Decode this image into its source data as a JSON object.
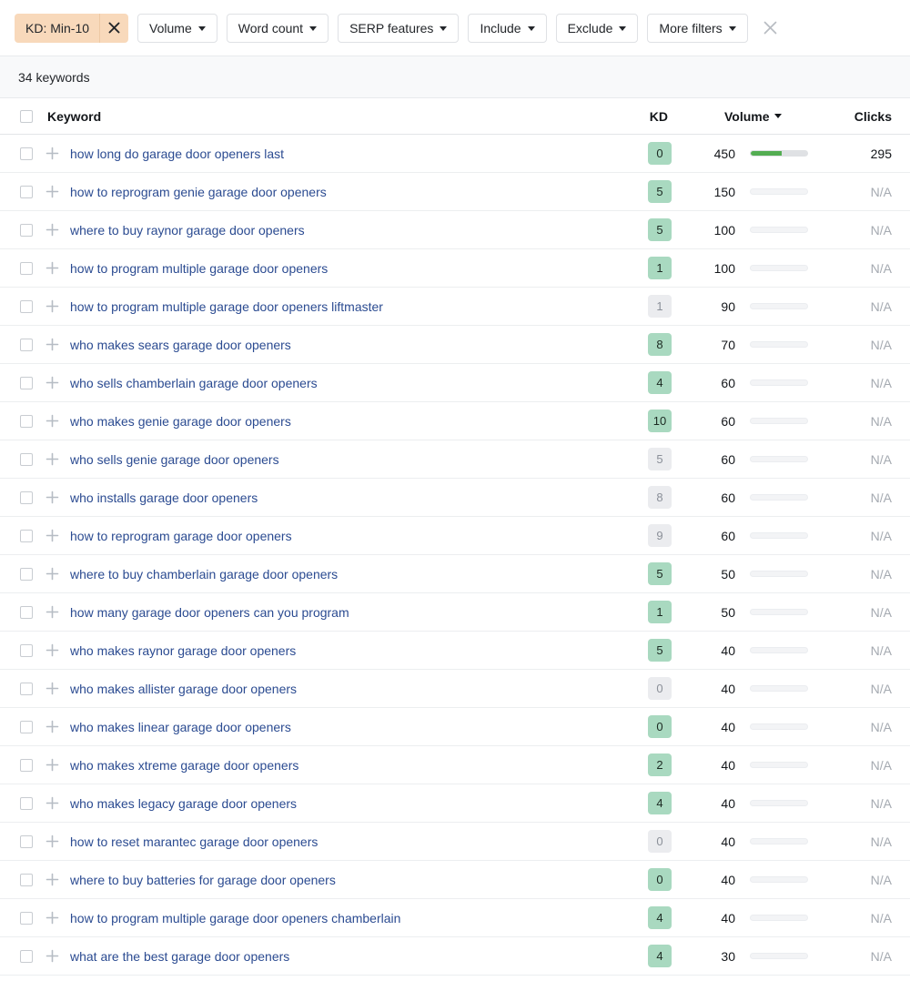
{
  "filters": {
    "active_chip": {
      "label": "KD: Min-10",
      "remove_icon": "close-icon"
    },
    "buttons": [
      {
        "label": "Volume"
      },
      {
        "label": "Word count"
      },
      {
        "label": "SERP features"
      },
      {
        "label": "Include"
      },
      {
        "label": "Exclude"
      },
      {
        "label": "More filters"
      }
    ],
    "clear_all_icon": "close-icon"
  },
  "count_bar": {
    "text": "34 keywords"
  },
  "table": {
    "headers": {
      "keyword": "Keyword",
      "kd": "KD",
      "volume": "Volume",
      "volume_sort_icon": "sort-descending-caret",
      "clicks": "Clicks"
    },
    "rows": [
      {
        "keyword": "how long do garage door openers last",
        "kd": "0",
        "kd_style": "green",
        "volume": "450",
        "bar_pct": 55,
        "bar_style": "filled",
        "clicks": "295",
        "clicks_na": false
      },
      {
        "keyword": "how to reprogram genie garage door openers",
        "kd": "5",
        "kd_style": "green",
        "volume": "150",
        "bar_pct": 0,
        "bar_style": "empty",
        "clicks": "N/A",
        "clicks_na": true
      },
      {
        "keyword": "where to buy raynor garage door openers",
        "kd": "5",
        "kd_style": "green",
        "volume": "100",
        "bar_pct": 0,
        "bar_style": "empty",
        "clicks": "N/A",
        "clicks_na": true
      },
      {
        "keyword": "how to program multiple garage door openers",
        "kd": "1",
        "kd_style": "green",
        "volume": "100",
        "bar_pct": 0,
        "bar_style": "empty",
        "clicks": "N/A",
        "clicks_na": true
      },
      {
        "keyword": "how to program multiple garage door openers liftmaster",
        "kd": "1",
        "kd_style": "gray",
        "volume": "90",
        "bar_pct": 0,
        "bar_style": "empty",
        "clicks": "N/A",
        "clicks_na": true
      },
      {
        "keyword": "who makes sears garage door openers",
        "kd": "8",
        "kd_style": "green",
        "volume": "70",
        "bar_pct": 0,
        "bar_style": "empty",
        "clicks": "N/A",
        "clicks_na": true
      },
      {
        "keyword": "who sells chamberlain garage door openers",
        "kd": "4",
        "kd_style": "green",
        "volume": "60",
        "bar_pct": 0,
        "bar_style": "empty",
        "clicks": "N/A",
        "clicks_na": true
      },
      {
        "keyword": "who makes genie garage door openers",
        "kd": "10",
        "kd_style": "green",
        "volume": "60",
        "bar_pct": 0,
        "bar_style": "empty",
        "clicks": "N/A",
        "clicks_na": true
      },
      {
        "keyword": "who sells genie garage door openers",
        "kd": "5",
        "kd_style": "gray",
        "volume": "60",
        "bar_pct": 0,
        "bar_style": "empty",
        "clicks": "N/A",
        "clicks_na": true
      },
      {
        "keyword": "who installs garage door openers",
        "kd": "8",
        "kd_style": "gray",
        "volume": "60",
        "bar_pct": 0,
        "bar_style": "empty",
        "clicks": "N/A",
        "clicks_na": true
      },
      {
        "keyword": "how to reprogram garage door openers",
        "kd": "9",
        "kd_style": "gray",
        "volume": "60",
        "bar_pct": 0,
        "bar_style": "empty",
        "clicks": "N/A",
        "clicks_na": true
      },
      {
        "keyword": "where to buy chamberlain garage door openers",
        "kd": "5",
        "kd_style": "green",
        "volume": "50",
        "bar_pct": 0,
        "bar_style": "empty",
        "clicks": "N/A",
        "clicks_na": true
      },
      {
        "keyword": "how many garage door openers can you program",
        "kd": "1",
        "kd_style": "green",
        "volume": "50",
        "bar_pct": 0,
        "bar_style": "empty",
        "clicks": "N/A",
        "clicks_na": true
      },
      {
        "keyword": "who makes raynor garage door openers",
        "kd": "5",
        "kd_style": "green",
        "volume": "40",
        "bar_pct": 0,
        "bar_style": "empty",
        "clicks": "N/A",
        "clicks_na": true
      },
      {
        "keyword": "who makes allister garage door openers",
        "kd": "0",
        "kd_style": "gray",
        "volume": "40",
        "bar_pct": 0,
        "bar_style": "empty",
        "clicks": "N/A",
        "clicks_na": true
      },
      {
        "keyword": "who makes linear garage door openers",
        "kd": "0",
        "kd_style": "green",
        "volume": "40",
        "bar_pct": 0,
        "bar_style": "empty",
        "clicks": "N/A",
        "clicks_na": true
      },
      {
        "keyword": "who makes xtreme garage door openers",
        "kd": "2",
        "kd_style": "green",
        "volume": "40",
        "bar_pct": 0,
        "bar_style": "empty",
        "clicks": "N/A",
        "clicks_na": true
      },
      {
        "keyword": "who makes legacy garage door openers",
        "kd": "4",
        "kd_style": "green",
        "volume": "40",
        "bar_pct": 0,
        "bar_style": "empty",
        "clicks": "N/A",
        "clicks_na": true
      },
      {
        "keyword": "how to reset marantec garage door openers",
        "kd": "0",
        "kd_style": "gray",
        "volume": "40",
        "bar_pct": 0,
        "bar_style": "empty",
        "clicks": "N/A",
        "clicks_na": true
      },
      {
        "keyword": "where to buy batteries for garage door openers",
        "kd": "0",
        "kd_style": "green",
        "volume": "40",
        "bar_pct": 0,
        "bar_style": "empty",
        "clicks": "N/A",
        "clicks_na": true
      },
      {
        "keyword": "how to program multiple garage door openers chamberlain",
        "kd": "4",
        "kd_style": "green",
        "volume": "40",
        "bar_pct": 0,
        "bar_style": "empty",
        "clicks": "N/A",
        "clicks_na": true
      },
      {
        "keyword": "what are the best garage door openers",
        "kd": "4",
        "kd_style": "green",
        "volume": "30",
        "bar_pct": 0,
        "bar_style": "empty",
        "clicks": "N/A",
        "clicks_na": true
      }
    ]
  },
  "colors": {
    "chip_bg": "#f8d9bb",
    "kd_green": "#a9d9c0",
    "kd_gray": "#ebecef",
    "bar_green": "#53ad52",
    "link_blue": "#2b4b91"
  }
}
